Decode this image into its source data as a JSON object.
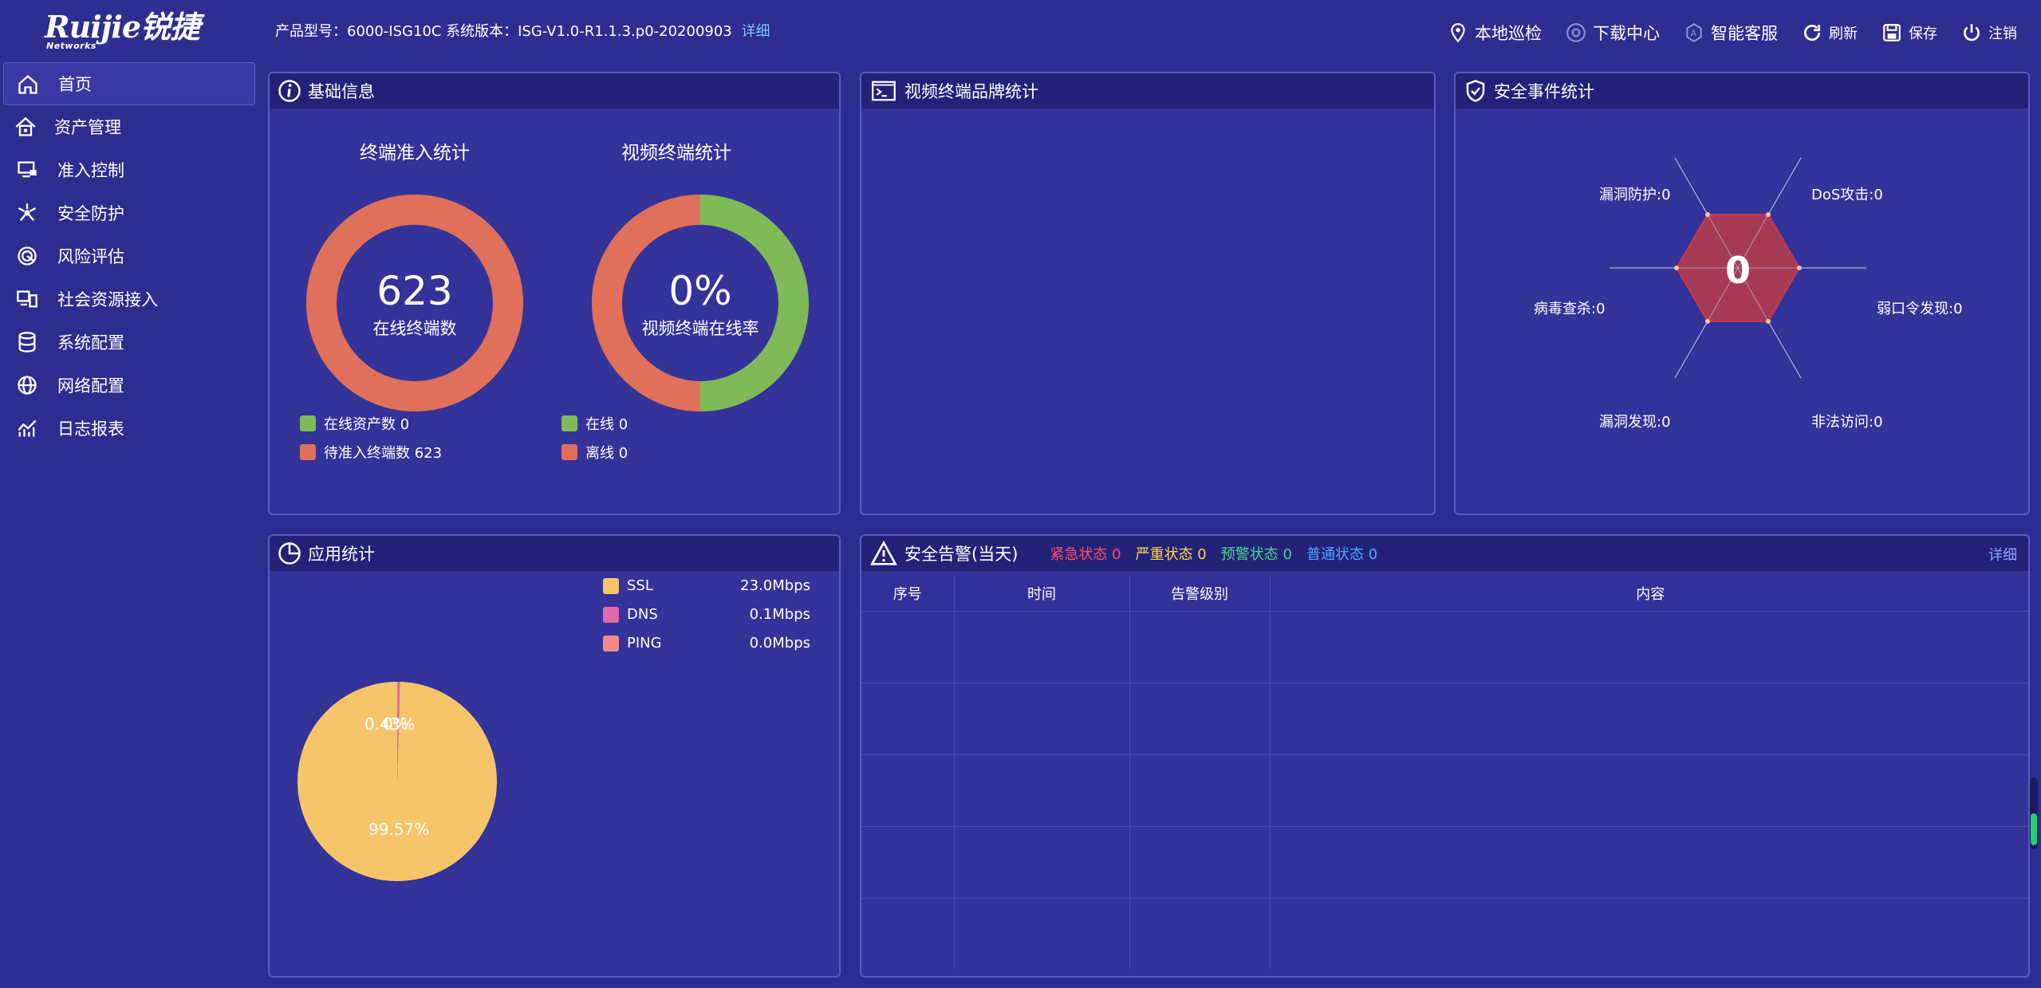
{
  "brand": {
    "logo_text": "Ruijie锐捷",
    "logo_sub": "Networks"
  },
  "header": {
    "product_info": "产品型号：6000-ISG10C 系统版本：ISG-V1.0-R1.1.3.p0-20200903",
    "detail_link": "详细",
    "actions": [
      {
        "label": "本地巡检",
        "icon": "location-pin-icon"
      },
      {
        "label": "下载中心",
        "icon": "download-icon"
      },
      {
        "label": "智能客服",
        "icon": "service-icon"
      },
      {
        "label": "刷新",
        "icon": "refresh-icon"
      },
      {
        "label": "保存",
        "icon": "save-icon"
      },
      {
        "label": "注销",
        "icon": "power-icon"
      }
    ]
  },
  "sidebar": {
    "items": [
      {
        "label": "首页",
        "icon": "home-icon",
        "active": true
      },
      {
        "label": "资产管理",
        "icon": "asset-house-icon"
      },
      {
        "label": "准入控制",
        "icon": "monitor-lock-icon"
      },
      {
        "label": "安全防护",
        "icon": "shield-network-icon"
      },
      {
        "label": "风险评估",
        "icon": "radar-icon"
      },
      {
        "label": "社会资源接入",
        "icon": "resource-icon"
      },
      {
        "label": "系统配置",
        "icon": "database-icon"
      },
      {
        "label": "网络配置",
        "icon": "globe-icon"
      },
      {
        "label": "日志报表",
        "icon": "chart-icon"
      }
    ]
  },
  "basic_info": {
    "title": "基础信息",
    "terminal_chart": {
      "title": "终端准入统计",
      "center_value": "623",
      "center_label": "在线终端数",
      "legend": [
        {
          "label": "在线资产数 0",
          "color": "#7fba56"
        },
        {
          "label": "待准入终端数 623",
          "color": "#e0705a"
        }
      ]
    },
    "video_chart": {
      "title": "视频终端统计",
      "center_value": "0%",
      "center_label": "视频终端在线率",
      "legend": [
        {
          "label": "在线 0",
          "color": "#7fba56"
        },
        {
          "label": "离线 0",
          "color": "#e0705a"
        }
      ]
    }
  },
  "video_brand": {
    "title": "视频终端品牌统计"
  },
  "security_events": {
    "title": "安全事件统计",
    "center_value": "0",
    "labels": {
      "top_left": "漏洞防护:0",
      "top_right": "DoS攻击:0",
      "left": "病毒查杀:0",
      "right": "弱口令发现:0",
      "bottom_left": "漏洞发现:0",
      "bottom_right": "非法访问:0"
    }
  },
  "app_stats": {
    "title": "应用统计",
    "legend": [
      {
        "name": "SSL",
        "value": "23.0Mbps",
        "color": "#f6c56a"
      },
      {
        "name": "DNS",
        "value": "0.1Mbps",
        "color": "#e06aa8"
      },
      {
        "name": "PING",
        "value": "0.0Mbps",
        "color": "#f08a8a"
      }
    ],
    "pie_labels": {
      "small": "0.43%",
      "small2": "0%",
      "large": "99.57%"
    }
  },
  "chart_data": {
    "type": "pie",
    "categories": [
      "SSL",
      "DNS",
      "PING"
    ],
    "values": [
      99.57,
      0.43,
      0.0
    ],
    "colors": [
      "#f6c56a",
      "#e06aa8",
      "#f08a8a"
    ]
  },
  "alerts": {
    "title": "安全告警(当天)",
    "statuses": [
      {
        "label": "紧急状态 0",
        "color": "#ff4d6a"
      },
      {
        "label": "严重状态 0",
        "color": "#ffd84d"
      },
      {
        "label": "预警状态 0",
        "color": "#4dd68c"
      },
      {
        "label": "普通状态 0",
        "color": "#4da8ff"
      }
    ],
    "detail": "详细",
    "columns": [
      "序号",
      "时间",
      "告警级别",
      "内容"
    ]
  }
}
